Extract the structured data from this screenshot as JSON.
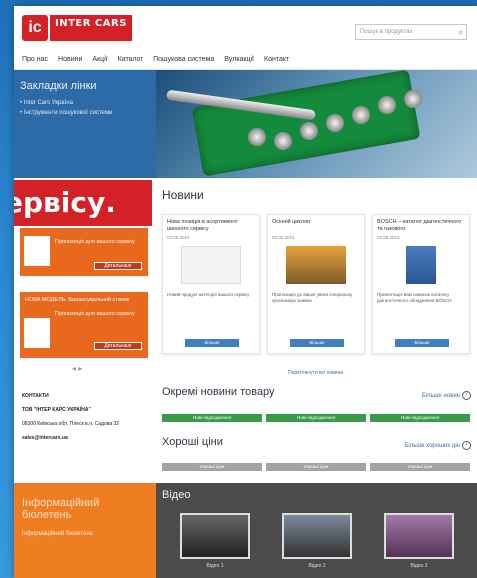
{
  "header": {
    "logo_mark": "ic",
    "logo_text": "INTER CARS",
    "search_placeholder": "Пошук в продуктах"
  },
  "nav": [
    "Про нас",
    "Новини",
    "Акції",
    "Каталог",
    "Пошукова система",
    "Вулкакції",
    "Контакт"
  ],
  "hero": {
    "title": "Закладки лінки",
    "links": [
      "Inter Cars Україна",
      "Інструменти пошукової системи"
    ]
  },
  "banner": "ервісу.",
  "left": {
    "promos": [
      {
        "title": "",
        "text": "Пропозиція для вашого сервісу",
        "button": "Детальніше"
      },
      {
        "title": "НОВА МОДЕЛЬ. Балансувальний станок",
        "text": "Пропозиція для вашого сервісу",
        "button": "Детальніше"
      }
    ],
    "arrows": "◂ ▸",
    "contacts_title": "КОНТАКТИ",
    "company": "ТОВ \"ІНТЕР КАРС УКРАЇНА\"",
    "address": "08300 Київська обл. Плеск в.п. Садова 32",
    "email": "sales@intercars.ua",
    "newsletter_title": "Інформаційний бюлетень",
    "newsletter_sub": "Інформаційний бюлетень"
  },
  "news": {
    "title": "Новини",
    "cards": [
      {
        "title": "Нова позиція в асортименті шинного сервісу",
        "date": "03.06.2016",
        "text": "Новий продукт категорії вашого сервісу",
        "button": "Більше"
      },
      {
        "title": "Осінній циклоп",
        "date": "03.06.2016",
        "text": "Пропозиція до вашої уваги спеціальну пропозицію знижки",
        "button": "Більше"
      },
      {
        "title": "BOSCH – каталог діагностичного та газового",
        "date": "03.06.2016",
        "text": "Презентація вам новинок каталогу діагностичного обладнання BOSCH",
        "button": "Більше"
      }
    ],
    "archive": "Переглянути всі новини"
  },
  "featured": {
    "title": "Окремі новини товару",
    "more": "Більше новин",
    "tabs": [
      "Нові надходження",
      "Нові надходження",
      "Нові надходження"
    ]
  },
  "prices": {
    "title": "Хороші ціни",
    "more": "Більше хороших цін",
    "tabs": [
      "Хороші ціни",
      "Хороші ціни",
      "Хороші ціни"
    ]
  },
  "video": {
    "title": "Відео",
    "items": [
      "Відео 1",
      "Відео 2",
      "Відео 3"
    ]
  },
  "colors": {
    "brand_red": "#d42027",
    "orange": "#ef7d22",
    "green": "#3a9b48",
    "grey_tab": "#a3a3a3",
    "blue_btn": "#3f7fc1"
  }
}
